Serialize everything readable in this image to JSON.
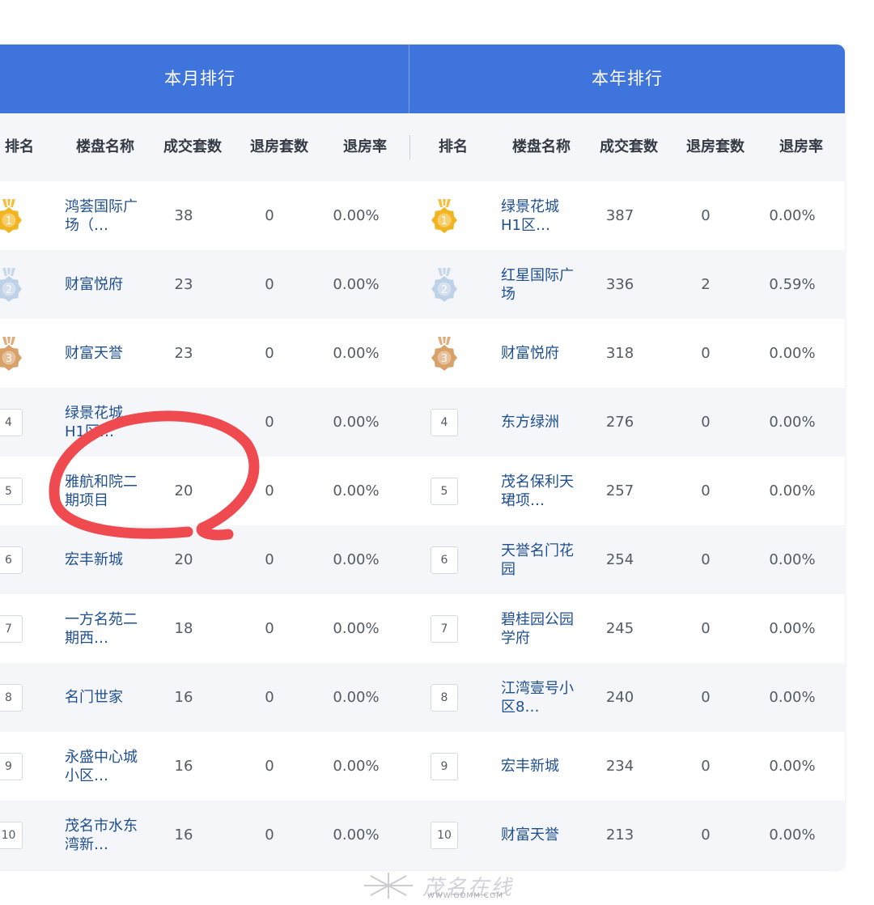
{
  "tabs": {
    "monthly": "本月排行",
    "yearly": "本年排行"
  },
  "columns": [
    "排名",
    "楼盘名称",
    "成交套数",
    "退房套数",
    "退房率"
  ],
  "medal_colors": {
    "1": "#f2b522",
    "2": "#bfd1e6",
    "3": "#d9a068"
  },
  "monthly_rows": [
    {
      "rank": "1",
      "name": "鸿荟国际广场（…",
      "sold": "38",
      "returned": "0",
      "rate": "0.00%"
    },
    {
      "rank": "2",
      "name": "财富悦府",
      "sold": "23",
      "returned": "0",
      "rate": "0.00%"
    },
    {
      "rank": "3",
      "name": "财富天誉",
      "sold": "23",
      "returned": "0",
      "rate": "0.00%"
    },
    {
      "rank": "4",
      "name": "绿景花城H1区…",
      "sold": "",
      "returned": "0",
      "rate": "0.00%"
    },
    {
      "rank": "5",
      "name": "雅航和院二期项目",
      "sold": "20",
      "returned": "0",
      "rate": "0.00%"
    },
    {
      "rank": "6",
      "name": "宏丰新城",
      "sold": "20",
      "returned": "0",
      "rate": "0.00%"
    },
    {
      "rank": "7",
      "name": "一方名苑二期西…",
      "sold": "18",
      "returned": "0",
      "rate": "0.00%"
    },
    {
      "rank": "8",
      "name": "名门世家",
      "sold": "16",
      "returned": "0",
      "rate": "0.00%"
    },
    {
      "rank": "9",
      "name": "永盛中心城小区…",
      "sold": "16",
      "returned": "0",
      "rate": "0.00%"
    },
    {
      "rank": "10",
      "name": "茂名市水东湾新…",
      "sold": "16",
      "returned": "0",
      "rate": "0.00%"
    }
  ],
  "yearly_rows": [
    {
      "rank": "1",
      "name": "绿景花城H1区…",
      "sold": "387",
      "returned": "0",
      "rate": "0.00%"
    },
    {
      "rank": "2",
      "name": "红星国际广场",
      "sold": "336",
      "returned": "2",
      "rate": "0.59%"
    },
    {
      "rank": "3",
      "name": "财富悦府",
      "sold": "318",
      "returned": "0",
      "rate": "0.00%"
    },
    {
      "rank": "4",
      "name": "东方绿洲",
      "sold": "276",
      "returned": "0",
      "rate": "0.00%"
    },
    {
      "rank": "5",
      "name": "茂名保利天珺项…",
      "sold": "257",
      "returned": "0",
      "rate": "0.00%"
    },
    {
      "rank": "6",
      "name": "天誉名门花园",
      "sold": "254",
      "returned": "0",
      "rate": "0.00%"
    },
    {
      "rank": "7",
      "name": "碧桂园公园学府",
      "sold": "245",
      "returned": "0",
      "rate": "0.00%"
    },
    {
      "rank": "8",
      "name": "江湾壹号小区8…",
      "sold": "240",
      "returned": "0",
      "rate": "0.00%"
    },
    {
      "rank": "9",
      "name": "宏丰新城",
      "sold": "234",
      "returned": "0",
      "rate": "0.00%"
    },
    {
      "rank": "10",
      "name": "财富天誉",
      "sold": "213",
      "returned": "0",
      "rate": "0.00%"
    }
  ],
  "annotation_color": "#ee4a4f",
  "watermark": {
    "text": "茂名在线",
    "url": "WWW.GDMM.COM"
  }
}
